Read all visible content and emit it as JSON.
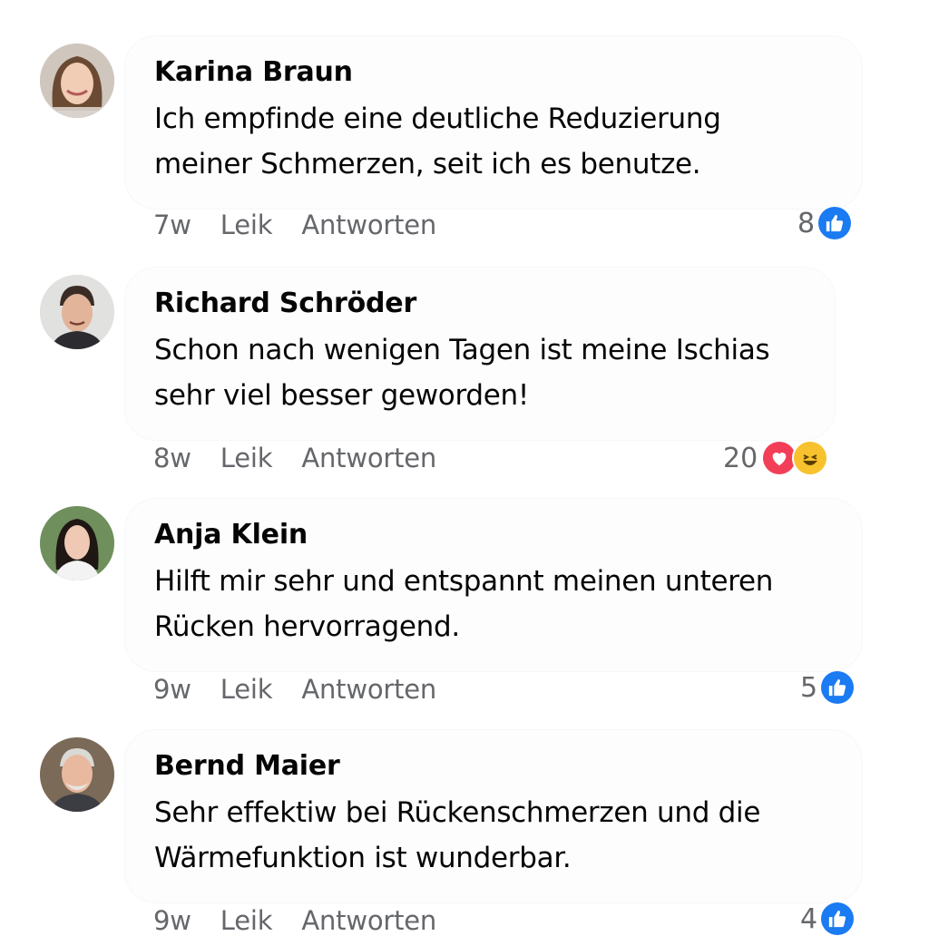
{
  "comments": [
    {
      "name": "Karina Braun",
      "line1": "Ich empfinde eine deutliche Reduzierung",
      "line2": "meiner Schmerzen, seit ich es benutze.",
      "time": "7w",
      "like_label": "Leik",
      "reply_label": "Antworten",
      "reaction_count": "8",
      "reaction_icons": [
        "like-icon"
      ]
    },
    {
      "name": "Richard Schröder",
      "line1": "Schon nach wenigen Tagen ist meine Ischias",
      "line2": "sehr viel besser geworden!",
      "time": "8w",
      "like_label": "Leik",
      "reply_label": "Antworten",
      "reaction_count": "20",
      "reaction_icons": [
        "heart-icon",
        "haha-icon"
      ]
    },
    {
      "name": "Anja Klein",
      "line1": "Hilft mir sehr und entspannt meinen unteren",
      "line2": "Rücken hervorragend.",
      "time": "9w",
      "like_label": "Leik",
      "reply_label": "Antworten",
      "reaction_count": "5",
      "reaction_icons": [
        "like-icon"
      ]
    },
    {
      "name": "Bernd Maier",
      "line1": "Sehr effektiw bei Rückenschmerzen und die",
      "line2": "Wärmefunktion ist wunderbar.",
      "time": "9w",
      "like_label": "Leik",
      "reply_label": "Antworten",
      "reaction_count": "4",
      "reaction_icons": [
        "like-icon"
      ]
    }
  ],
  "colors": {
    "like_blue": "#1a7bf2",
    "love_red": "#f33e58",
    "haha_yellow": "#f7c22d",
    "meta_gray": "#65676b"
  }
}
